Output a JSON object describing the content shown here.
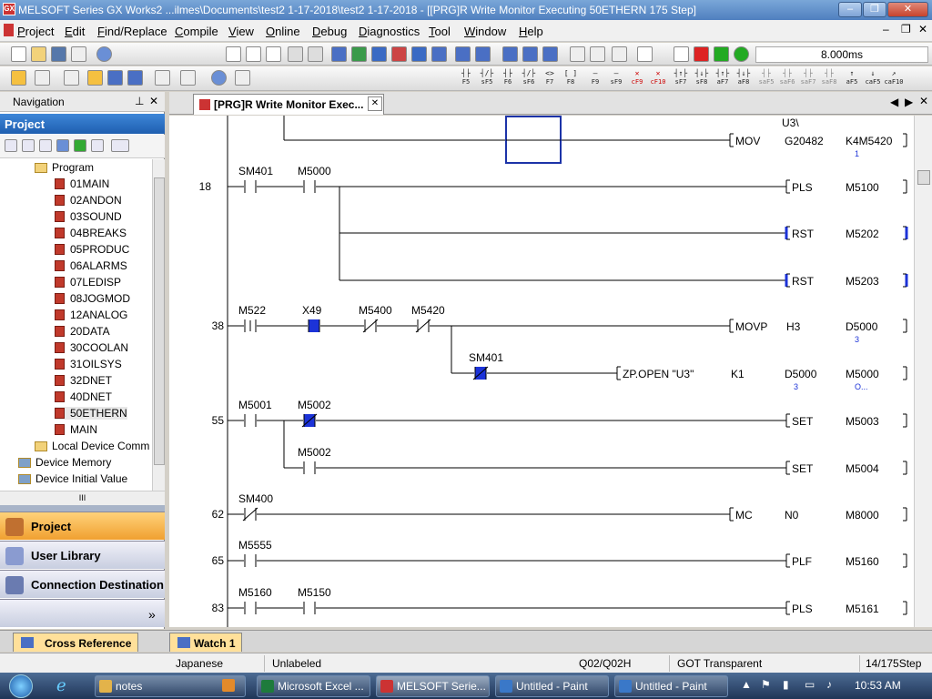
{
  "window": {
    "title": "MELSOFT Series GX Works2 ...ilmes\\Documents\\test2 1-17-2018\\test2 1-17-2018 - [[PRG]R Write Monitor Executing 50ETHERN 175 Step]",
    "app_icon": "GX"
  },
  "menu": {
    "items": [
      "Project",
      "Edit",
      "Find/Replace",
      "Compile",
      "View",
      "Online",
      "Debug",
      "Diagnostics",
      "Tool",
      "Window",
      "Help"
    ]
  },
  "toolbar": {
    "scan_time": "8.000ms",
    "fkeys": [
      {
        "sym": "┤├",
        "key": "F5"
      },
      {
        "sym": "┤/├",
        "key": "sF5"
      },
      {
        "sym": "┤├",
        "key": "F6"
      },
      {
        "sym": "┤/├",
        "key": "sF6"
      },
      {
        "sym": "<>",
        "key": "F7"
      },
      {
        "sym": "[ ]",
        "key": "F8"
      },
      {
        "sym": "—",
        "key": "F9"
      },
      {
        "sym": "—",
        "key": "sF9"
      },
      {
        "sym": "✕",
        "key": "cF9"
      },
      {
        "sym": "✕",
        "key": "cF10"
      },
      {
        "sym": "┤↑├",
        "key": "sF7"
      },
      {
        "sym": "┤↓├",
        "key": "sF8"
      },
      {
        "sym": "┤↑├",
        "key": "aF7"
      },
      {
        "sym": "┤↓├",
        "key": "aF8"
      },
      {
        "sym": "┤├",
        "key": "saF5"
      },
      {
        "sym": "┤├",
        "key": "saF6"
      },
      {
        "sym": "┤├",
        "key": "saF7"
      },
      {
        "sym": "┤├",
        "key": "saF8"
      },
      {
        "sym": "↑",
        "key": "aF5"
      },
      {
        "sym": "↓",
        "key": "caF5"
      },
      {
        "sym": "↗",
        "key": "caF10"
      }
    ]
  },
  "navigation": {
    "header": "Navigation",
    "panel": "Project",
    "tree": [
      {
        "label": "Program",
        "level": 1,
        "type": "folder"
      },
      {
        "label": "01MAIN",
        "level": 2,
        "type": "prg"
      },
      {
        "label": "02ANDON",
        "level": 2,
        "type": "prg"
      },
      {
        "label": "03SOUND",
        "level": 2,
        "type": "prg"
      },
      {
        "label": "04BREAKS",
        "level": 2,
        "type": "prg"
      },
      {
        "label": "05PRODUC",
        "level": 2,
        "type": "prg"
      },
      {
        "label": "06ALARMS",
        "level": 2,
        "type": "prg"
      },
      {
        "label": "07LEDISP",
        "level": 2,
        "type": "prg"
      },
      {
        "label": "08JOGMOD",
        "level": 2,
        "type": "prg"
      },
      {
        "label": "12ANALOG",
        "level": 2,
        "type": "prg"
      },
      {
        "label": "20DATA",
        "level": 2,
        "type": "prg"
      },
      {
        "label": "30COOLAN",
        "level": 2,
        "type": "prg"
      },
      {
        "label": "31OILSYS",
        "level": 2,
        "type": "prg"
      },
      {
        "label": "32DNET",
        "level": 2,
        "type": "prg"
      },
      {
        "label": "40DNET",
        "level": 2,
        "type": "prg"
      },
      {
        "label": "50ETHERN",
        "level": 2,
        "type": "prg"
      },
      {
        "label": "MAIN",
        "level": 2,
        "type": "prg"
      },
      {
        "label": "Local Device Comm",
        "level": 1,
        "type": "folder"
      },
      {
        "label": "Device Memory",
        "level": 0,
        "type": "mem"
      },
      {
        "label": "Device Initial Value",
        "level": 0,
        "type": "mem"
      }
    ],
    "scroll_label": "III",
    "buttons": [
      {
        "label": "Project",
        "color": "#f5a623"
      },
      {
        "label": "User Library",
        "color": "#d8d8e8"
      },
      {
        "label": "Connection Destination",
        "color": "#d8d8e8"
      }
    ],
    "more": "»"
  },
  "document_tab": {
    "label": "[PRG]R Write Monitor Exec...",
    "close": "✕"
  },
  "ladder": {
    "rungs": [
      {
        "step": "",
        "top_labels": [
          "U3\\"
        ],
        "instr": "MOV",
        "ops": [
          "G20482",
          "K4M5420"
        ],
        "subs": [
          "1"
        ]
      },
      {
        "step": "18",
        "contacts": [
          "SM401",
          "M5000"
        ],
        "outputs": [
          {
            "instr": "PLS",
            "op": "M5100"
          },
          {
            "instr": "RST",
            "op": "M5202"
          },
          {
            "instr": "RST",
            "op": "M5203"
          }
        ]
      },
      {
        "step": "38",
        "contacts": [
          "M522",
          "X49",
          "M5400",
          "M5420"
        ],
        "instr": "MOVP",
        "ops": [
          "H3",
          "D5000"
        ],
        "subs": [
          "3"
        ],
        "branch": {
          "contact": "SM401",
          "instr": "ZP.OPEN \"U3\"",
          "ops": [
            "K1",
            "D5000",
            "M5000"
          ],
          "subs": [
            "3",
            "O..."
          ]
        }
      },
      {
        "step": "55",
        "contacts": [
          "M5001",
          "M5002"
        ],
        "outputs": [
          {
            "instr": "SET",
            "op": "M5003"
          }
        ],
        "branch": {
          "contact": "M5002",
          "instr": "SET",
          "op": "M5004"
        }
      },
      {
        "step": "62",
        "contacts": [
          "SM400"
        ],
        "instr": "MC",
        "ops": [
          "N0",
          "M8000"
        ]
      },
      {
        "step": "65",
        "contacts": [
          "M5555"
        ],
        "instr": "PLF",
        "ops": [
          "M5160"
        ]
      },
      {
        "step": "83",
        "contacts": [
          "M5160",
          "M5150"
        ],
        "instr": "PLS",
        "ops": [
          "M5161"
        ]
      }
    ]
  },
  "bottom_tabs": [
    "Cross Reference",
    "Watch 1"
  ],
  "status": {
    "language": "Japanese",
    "label": "Unlabeled",
    "cpu": "Q02/Q02H",
    "got": "GOT Transparent",
    "step": "14/175Step"
  },
  "taskbar": {
    "items": [
      {
        "label": "notes",
        "color": "#e3b34a"
      },
      {
        "label": "",
        "color": "#e38a2a"
      },
      {
        "label": "Microsoft Excel ...",
        "color": "#1e7b3c"
      },
      {
        "label": "MELSOFT Serie...",
        "color": "#c33"
      },
      {
        "label": "Untitled - Paint",
        "color": "#3a78c8"
      },
      {
        "label": "Untitled - Paint",
        "color": "#3a78c8"
      }
    ],
    "clock": "10:53 AM"
  }
}
